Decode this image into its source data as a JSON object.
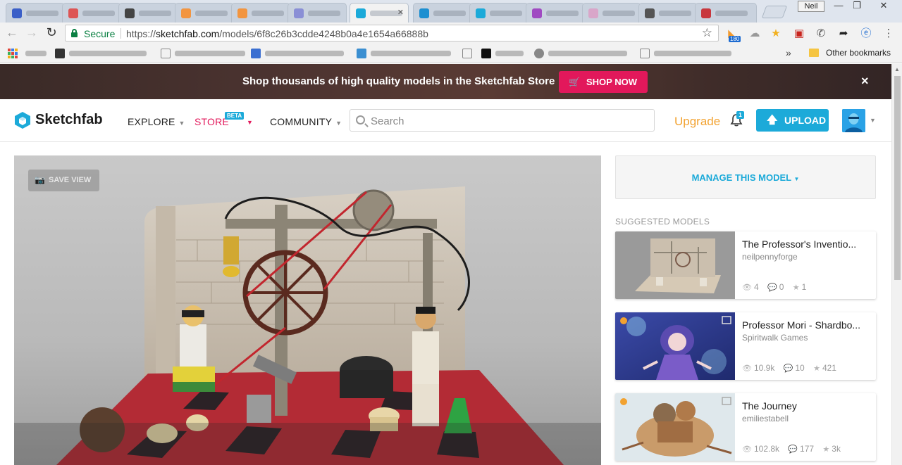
{
  "browser": {
    "profile_name": "Neil",
    "secure_label": "Secure",
    "url_scheme": "https://",
    "url_host": "sketchfab.com",
    "url_path": "/models/6f8c26b3cdde4248b0a4e1654a66888b",
    "rss_badge": "180",
    "other_bookmarks": "Other bookmarks"
  },
  "promo": {
    "text": "Shop thousands of high quality models in the Sketchfab Store",
    "button": "SHOP NOW",
    "close": "×"
  },
  "header": {
    "brand": "Sketchfab",
    "nav": {
      "explore": "EXPLORE",
      "store": "STORE",
      "store_badge": "BETA",
      "community": "COMMUNITY"
    },
    "search_placeholder": "Search",
    "upgrade": "Upgrade",
    "notification_count": "1",
    "upload": "UPLOAD"
  },
  "viewer": {
    "save_view": "SAVE VIEW"
  },
  "sidebar": {
    "manage": "MANAGE THIS MODEL",
    "suggested_title": "SUGGESTED MODELS",
    "cards": [
      {
        "title": "The Professor's Inventio...",
        "author": "neilpennyforge",
        "views": "4",
        "comments": "0",
        "likes": "1"
      },
      {
        "title": "Professor Mori - Shardbo...",
        "author": "Spiritwalk Games",
        "views": "10.9k",
        "comments": "10",
        "likes": "421"
      },
      {
        "title": "The Journey",
        "author": "emiliestabell",
        "views": "102.8k",
        "comments": "177",
        "likes": "3k"
      }
    ]
  },
  "colors": {
    "brand_blue": "#1caad9",
    "store_pink": "#e2185b",
    "upgrade_orange": "#f2a230"
  }
}
